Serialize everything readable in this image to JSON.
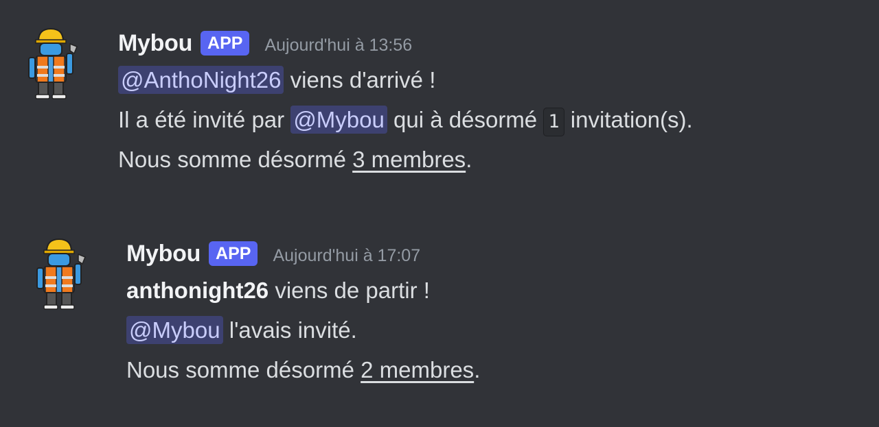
{
  "messages": [
    {
      "author": "Mybou",
      "badge": "APP",
      "timestamp": "Aujourd'hui à 13:56",
      "line1": {
        "mention": "@AnthoNight26",
        "text": " viens d'arrivé !"
      },
      "line2": {
        "prefix": "Il a été invité par ",
        "mention": "@Mybou",
        "middle": " qui à désormé ",
        "code": "1",
        "suffix": " invitation(s)."
      },
      "line3": {
        "prefix": "Nous somme désormé ",
        "link": "3 membres",
        "suffix": "."
      }
    },
    {
      "author": "Mybou",
      "badge": "APP",
      "timestamp": "Aujourd'hui à 17:07",
      "line1": {
        "bold": "anthonight26",
        "text": " viens de partir !"
      },
      "line2": {
        "mention": "@Mybou",
        "text": " l'avais invité."
      },
      "line3": {
        "prefix": "Nous somme désormé ",
        "link": "2 membres",
        "suffix": "."
      }
    }
  ],
  "colors": {
    "background": "#313338",
    "badge": "#5865f2",
    "mention_bg": "rgba(88,101,242,0.3)",
    "mention_text": "#c9cdfb",
    "timestamp": "#949ba4"
  },
  "icons": {
    "avatar": "construction-worker-robot-avatar"
  }
}
